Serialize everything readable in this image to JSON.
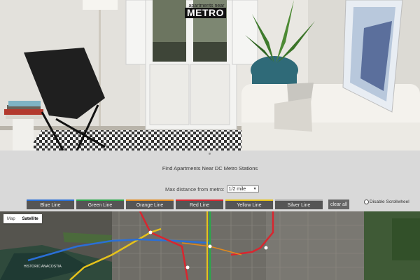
{
  "brand": {
    "small_text": "apartments near",
    "big_text": "METRO"
  },
  "headline": "Find Apartments Near DC Metro Stations",
  "distance": {
    "label": "Max distance from metro:",
    "selected": "1/2 mile"
  },
  "metro_lines": [
    {
      "label": "Blue Line",
      "color": "#2a6fd6"
    },
    {
      "label": "Green Line",
      "color": "#2aa84a"
    },
    {
      "label": "Orange Line",
      "color": "#e38a1c"
    },
    {
      "label": "Red Line",
      "color": "#d8262f"
    },
    {
      "label": "Yellow Line",
      "color": "#e6c21b"
    },
    {
      "label": "Silver Line",
      "color": "#a9a9a9"
    }
  ],
  "clear_label": "clear all",
  "scrollwheel_label": "Disable Scrollwheel",
  "map_type": {
    "map_label": "Map",
    "satellite_label": "Satellite"
  },
  "map_place_labels": [
    "HISTORIC ANACOSTIA"
  ]
}
